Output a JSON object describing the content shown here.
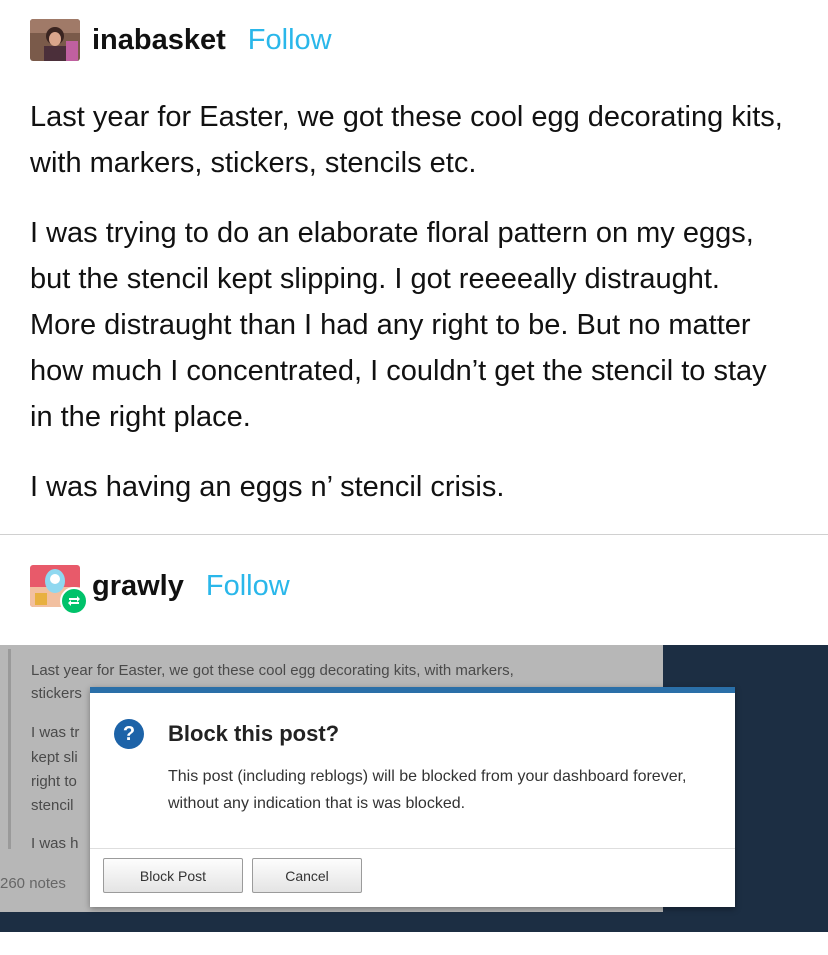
{
  "post1": {
    "username": "inabasket",
    "follow_label": "Follow",
    "paragraphs": [
      "Last year for Easter, we got these cool egg decorating kits, with markers, stickers, stencils etc.",
      "I was trying to do an elaborate floral pattern on my eggs, but the stencil kept slipping. I got reeeeally distraught. More distraught than I had any right to be. But no matter how much I concentrated, I couldn’t get the stencil to stay in the right place.",
      "I was having an eggs n’ stencil crisis."
    ]
  },
  "post2": {
    "username": "grawly",
    "follow_label": "Follow",
    "reblog_icon": "reblog-icon"
  },
  "screenshot": {
    "post_lines": [
      "Last year for Easter, we got these cool egg decorating kits, with markers,",
      "stickers",
      "I was tr",
      "kept sli",
      "right to",
      "stencil",
      "I was h"
    ],
    "notes": "260 notes",
    "dialog": {
      "icon": "question-icon",
      "title": "Block this post?",
      "body": "This post (including reblogs) will be blocked from your dashboard forever, without any indication that is was blocked.",
      "block_label": "Block Post",
      "cancel_label": "Cancel"
    }
  },
  "colors": {
    "follow": "#2ab7ea",
    "dialog_accent": "#2a6fa8",
    "screenshot_bg": "#1c2e43",
    "reblog_badge": "#00c26a"
  }
}
